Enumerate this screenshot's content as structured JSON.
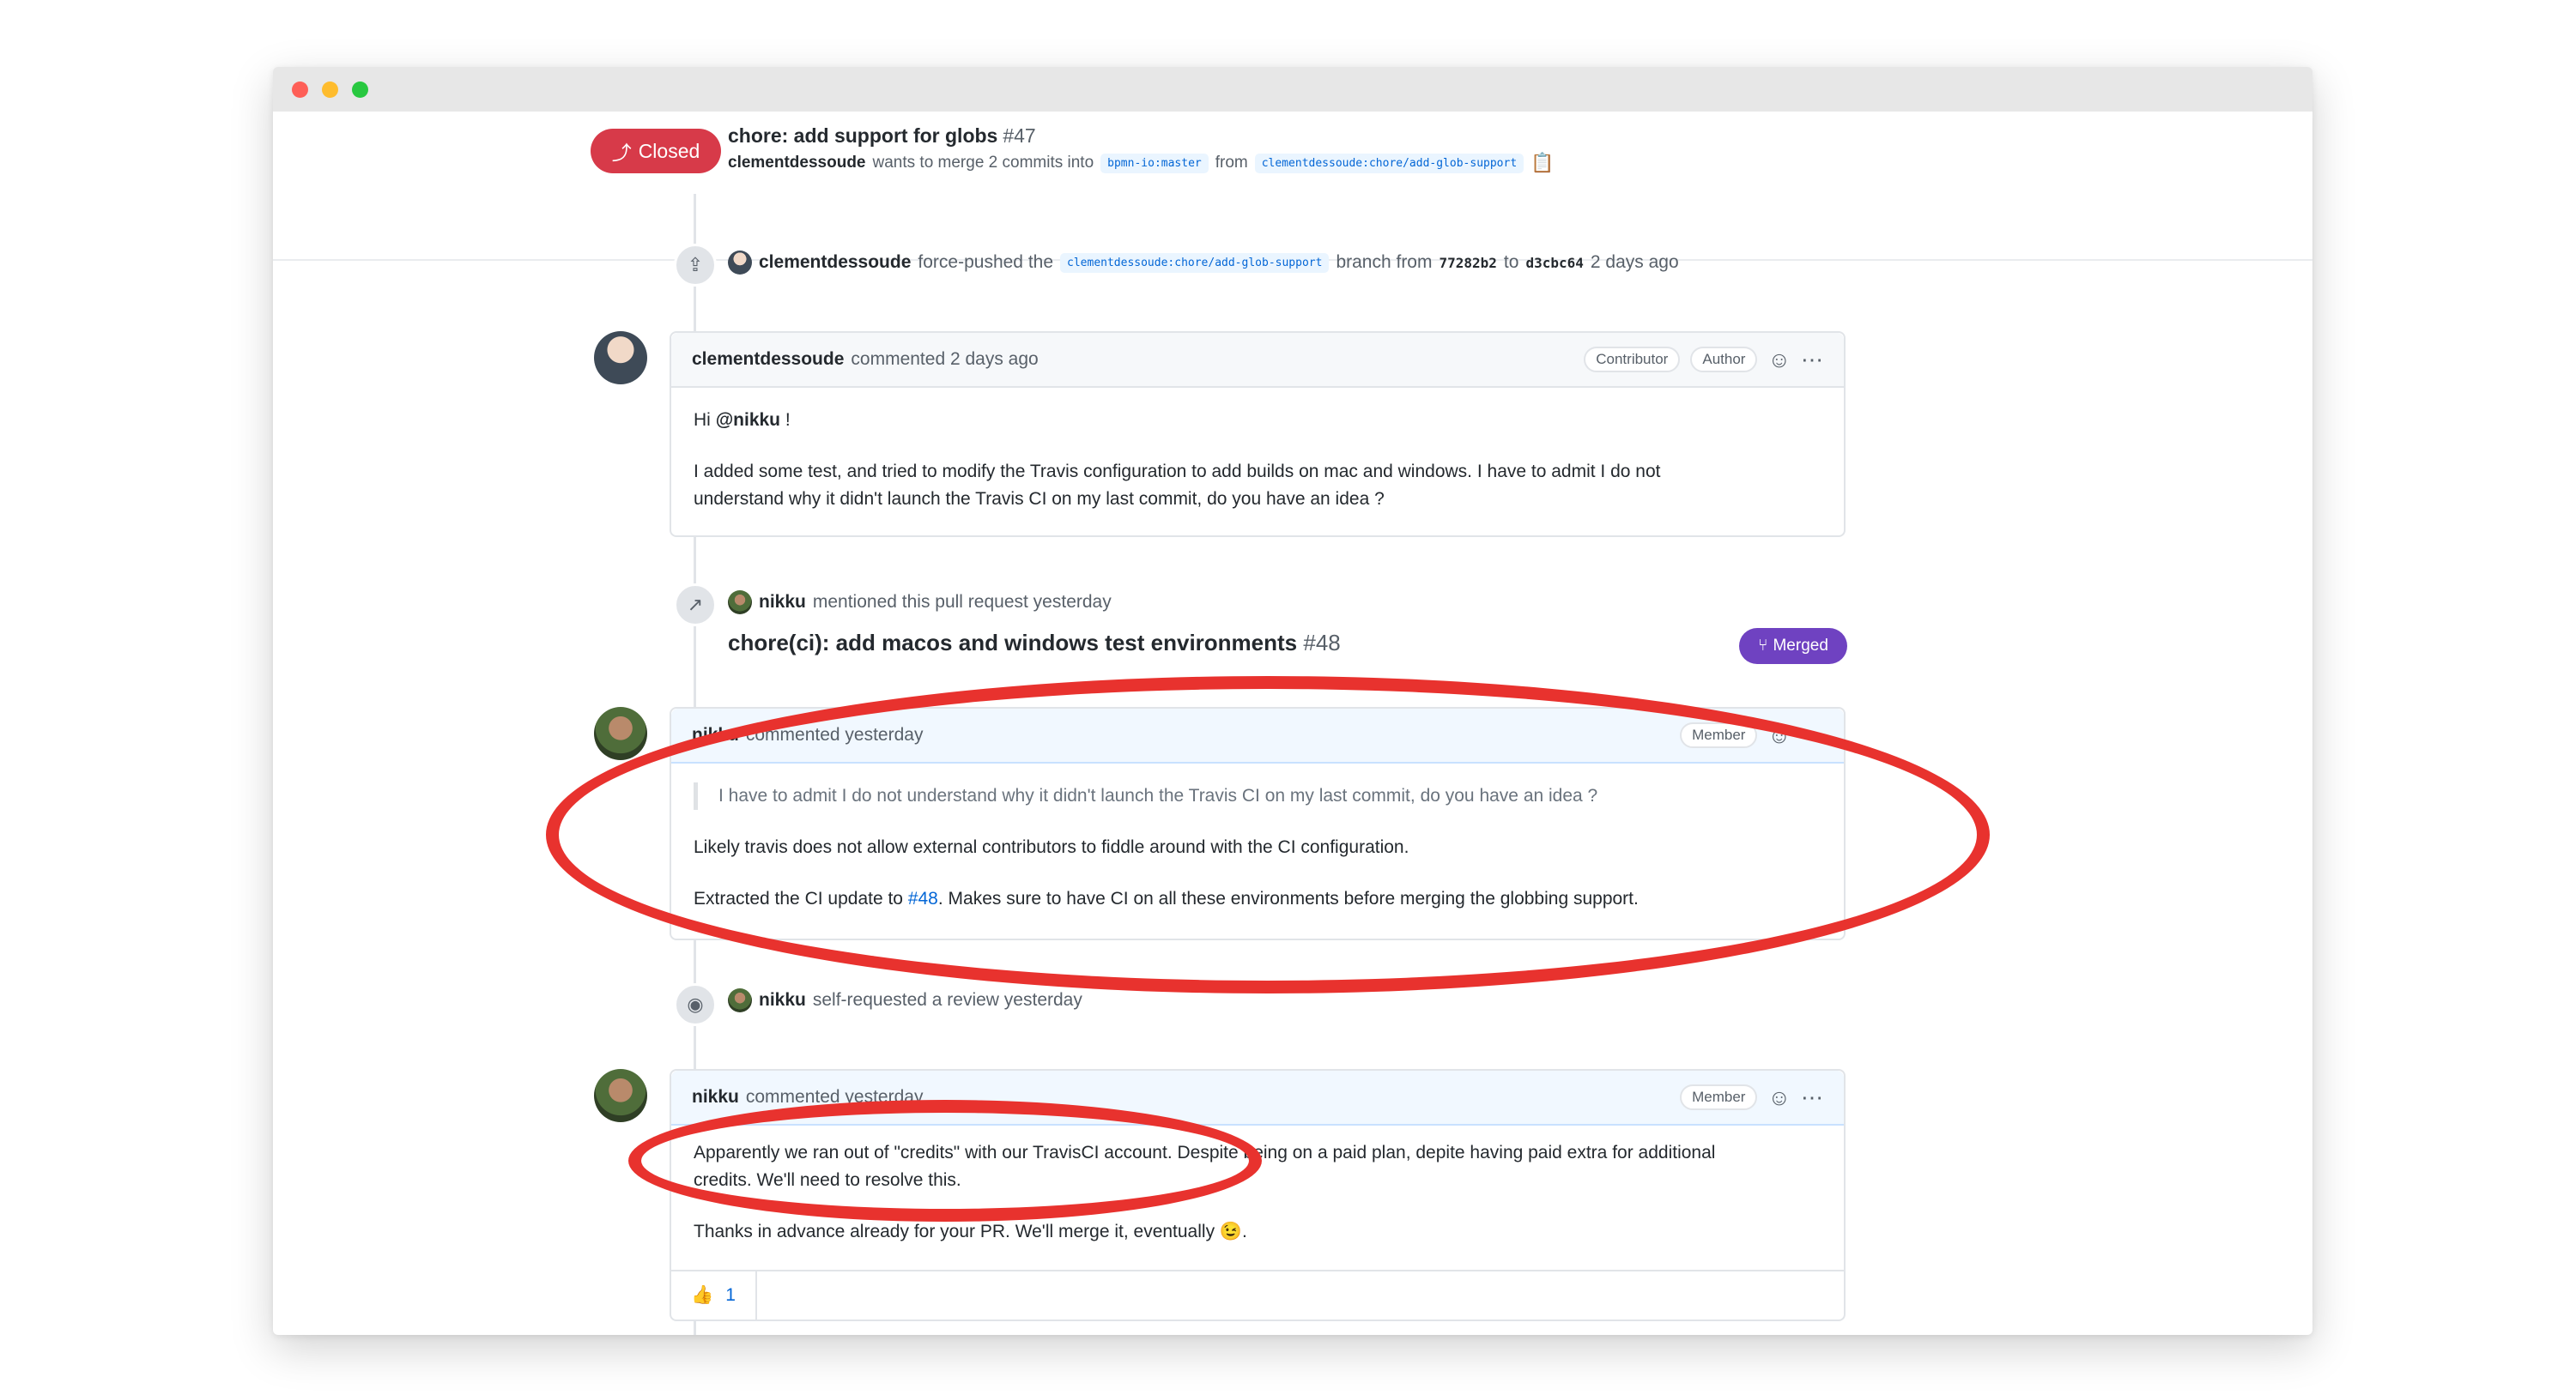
{
  "window": {
    "traffic_lights": [
      "close",
      "minimize",
      "maximize"
    ]
  },
  "pr": {
    "state": "Closed",
    "title": "chore: add support for globs",
    "number": "#47",
    "author": "clementdessoude",
    "merge_text": "wants to merge 2 commits into",
    "base_branch": "bpmn-io:master",
    "from_text": "from",
    "head_branch": "clementdessoude:chore/add-glob-support"
  },
  "timeline": {
    "force_push": {
      "user": "clementdessoude",
      "action": "force-pushed the",
      "branch": "clementdessoude:chore/add-glob-support",
      "branch_text": "branch from",
      "from_sha": "77282b2",
      "to_text": "to",
      "to_sha": "d3cbc64",
      "time": "2 days ago"
    },
    "comment1": {
      "user": "clementdessoude",
      "meta": "commented 2 days ago",
      "badges": [
        "Contributor",
        "Author"
      ],
      "greeting_prefix": "Hi",
      "mention": "@nikku",
      "greeting_suffix": "!",
      "body_line1": "I added some test, and tried to modify the Travis configuration to add builds on mac and windows. I have to admit I do not",
      "body_line2": "understand why it didn't launch the Travis CI on my last commit, do you have an idea ?"
    },
    "mention_event": {
      "user": "nikku",
      "action": "mentioned this pull request yesterday",
      "ref_title": "chore(ci): add macos and windows test environments",
      "ref_number": "#48",
      "ref_state": "Merged"
    },
    "comment2": {
      "user": "nikku",
      "meta": "commented yesterday",
      "badge": "Member",
      "quote": "I have to admit I do not understand why it didn't launch the Travis CI on my last commit, do you have an idea ?",
      "para1": "Likely travis does not allow external contributors to fiddle around with the CI configuration.",
      "para2_prefix": "Extracted the CI update to",
      "para2_link": "#48",
      "para2_suffix": ". Makes sure to have CI on all these environments before merging the globbing support."
    },
    "review_event": {
      "user": "nikku",
      "action": "self-requested a review yesterday"
    },
    "comment3": {
      "user": "nikku",
      "meta": "commented yesterday",
      "badge": "Member",
      "line1": "Apparently we ran out of \"credits\" with our TravisCI account. Despite being on a paid plan, depite having paid extra for additional",
      "line2": "credits. We'll need to resolve this.",
      "line3": "Thanks in advance already for your PR. We'll merge it, eventually 😉.",
      "reaction_emoji": "👍",
      "reaction_count": "1"
    }
  },
  "colors": {
    "closed": "#d73a49",
    "merged": "#6f42c1",
    "annotation": "#e8322e",
    "link": "#0366d6"
  }
}
